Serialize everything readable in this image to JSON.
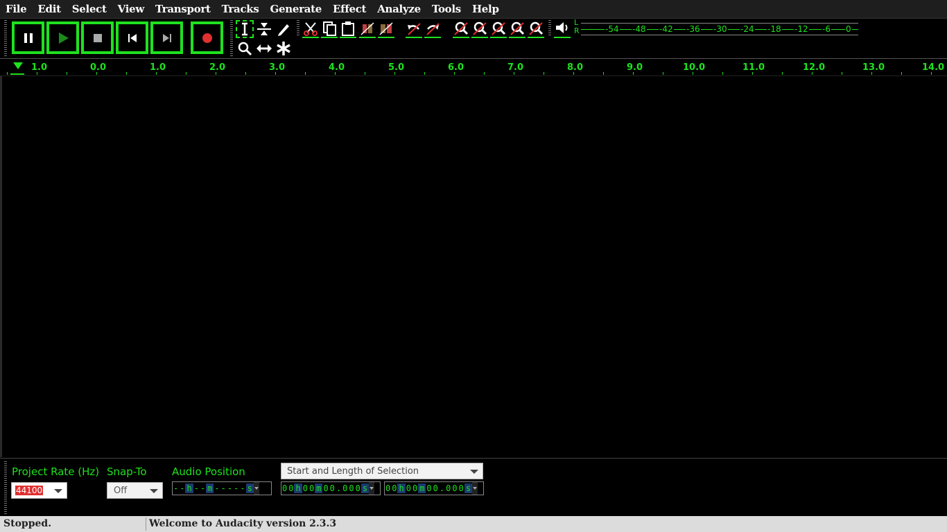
{
  "menu": [
    "File",
    "Edit",
    "Select",
    "View",
    "Transport",
    "Tracks",
    "Generate",
    "Effect",
    "Analyze",
    "Tools",
    "Help"
  ],
  "transport": {
    "buttons": [
      "pause",
      "play",
      "stop",
      "skip-to-start",
      "skip-to-end",
      "record"
    ]
  },
  "meter": {
    "l_label": "L",
    "r_label": "R",
    "ticks": [
      "-54",
      "-48",
      "-42",
      "-36",
      "-30",
      "-24",
      "-18",
      "-12",
      "-6",
      "0"
    ]
  },
  "ruler": {
    "labels": [
      "1.0",
      "0.0",
      "1.0",
      "2.0",
      "3.0",
      "4.0",
      "5.0",
      "6.0",
      "7.0",
      "8.0",
      "9.0",
      "10.0",
      "11.0",
      "12.0",
      "13.0",
      "14.0"
    ]
  },
  "selection_bar": {
    "project_rate_label": "Project Rate (Hz)",
    "project_rate_value": "44100",
    "snap_to_label": "Snap-To",
    "snap_to_value": "Off",
    "audio_position_label": "Audio Position",
    "selection_mode": "Start and Length of Selection",
    "audio_position_time": [
      "-",
      "-",
      "h",
      "-",
      "-",
      "m",
      "-",
      "-",
      "-",
      "-",
      "-",
      "s"
    ],
    "start_time": [
      "0",
      "0",
      "h",
      "0",
      "0",
      "m",
      "0",
      "0",
      ".",
      "0",
      "0",
      "0",
      "s"
    ],
    "length_time": [
      "0",
      "0",
      "h",
      "0",
      "0",
      "m",
      "0",
      "0",
      ".",
      "0",
      "0",
      "0",
      "s"
    ]
  },
  "status": {
    "left": "Stopped.",
    "right": "Welcome to Audacity version 2.3.3"
  },
  "colors": {
    "accent": "#1ee21e",
    "record": "#e03030",
    "background": "#000000"
  }
}
